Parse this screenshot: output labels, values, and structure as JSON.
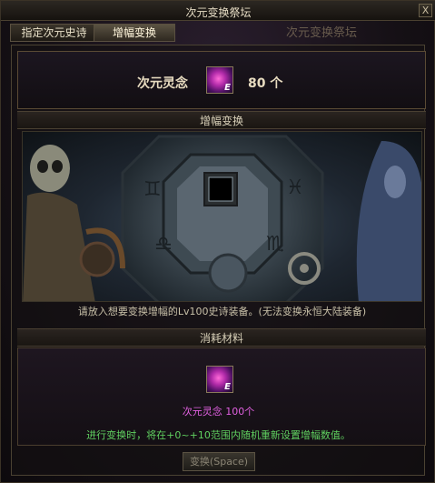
{
  "window": {
    "title": "次元变换祭坛",
    "close_label": "X"
  },
  "tabs": [
    {
      "label": "指定次元史诗",
      "active": false
    },
    {
      "label": "增幅变换",
      "active": true
    }
  ],
  "background_label": "次元变换祭坛",
  "currency": {
    "name": "次元灵念",
    "icon": "dimension-spirit-icon",
    "count": "80 个"
  },
  "sections": {
    "altar_header": "增幅变换",
    "altar_note": "请放入想要变换增幅的Lv100史诗装备。(无法变换永恒大陆装备)",
    "cost_header": "消耗材料"
  },
  "cost": {
    "icon": "dimension-spirit-icon",
    "text": "次元灵念 100个",
    "description": "进行变换时，将在+0~+10范围内随机重新设置增幅数值。"
  },
  "button": {
    "label": "变换(Space)",
    "enabled": false
  },
  "icon_mark": "E",
  "colors": {
    "cost_text": "#e060e0",
    "desc_text": "#60d060",
    "title": "#e6dcc4"
  }
}
